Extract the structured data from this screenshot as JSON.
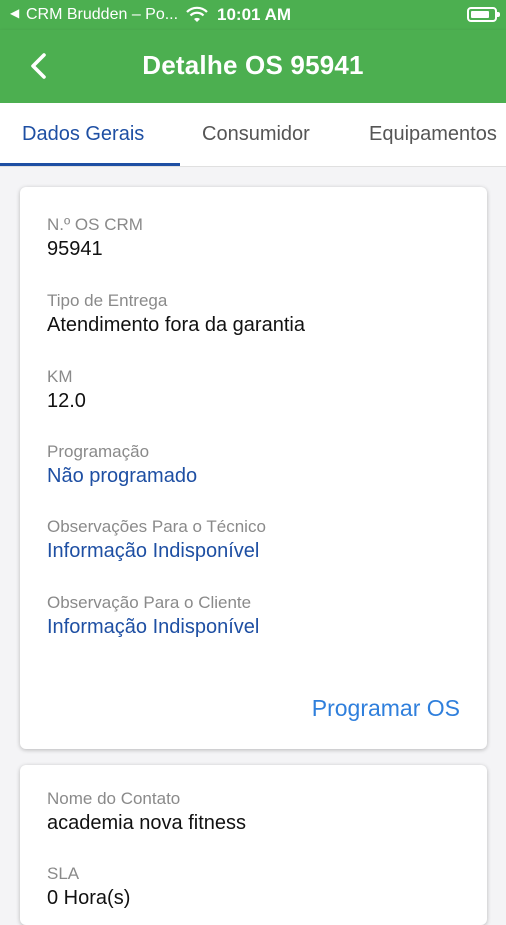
{
  "status_bar": {
    "back_app": "◀",
    "app_name": "CRM Brudden – Po...",
    "time": "10:01 AM"
  },
  "header": {
    "title": "Detalhe OS 95941"
  },
  "tabs": [
    {
      "label": "Dados Gerais",
      "active": true
    },
    {
      "label": "Consumidor",
      "active": false
    },
    {
      "label": "Equipamentos",
      "active": false
    }
  ],
  "details": {
    "os_crm": {
      "label": "N.º OS CRM",
      "value": "95941"
    },
    "tipo_entrega": {
      "label": "Tipo de Entrega",
      "value": "Atendimento fora da garantia"
    },
    "km": {
      "label": "KM",
      "value": "12.0"
    },
    "programacao": {
      "label": "Programação",
      "value": "Não programado"
    },
    "obs_tecnico": {
      "label": "Observações Para o Técnico",
      "value": "Informação Indisponível"
    },
    "obs_cliente": {
      "label": "Observação Para o Cliente",
      "value": "Informação Indisponível"
    },
    "action_label": "Programar OS"
  },
  "contact": {
    "nome": {
      "label": "Nome do Contato",
      "value": "academia nova fitness"
    },
    "sla": {
      "label": "SLA",
      "value": "0 Hora(s)"
    }
  },
  "colors": {
    "primary": "#4caf50",
    "tab_active": "#1e4fa3",
    "link": "#1e4fa3",
    "action": "#2f7fdc"
  }
}
